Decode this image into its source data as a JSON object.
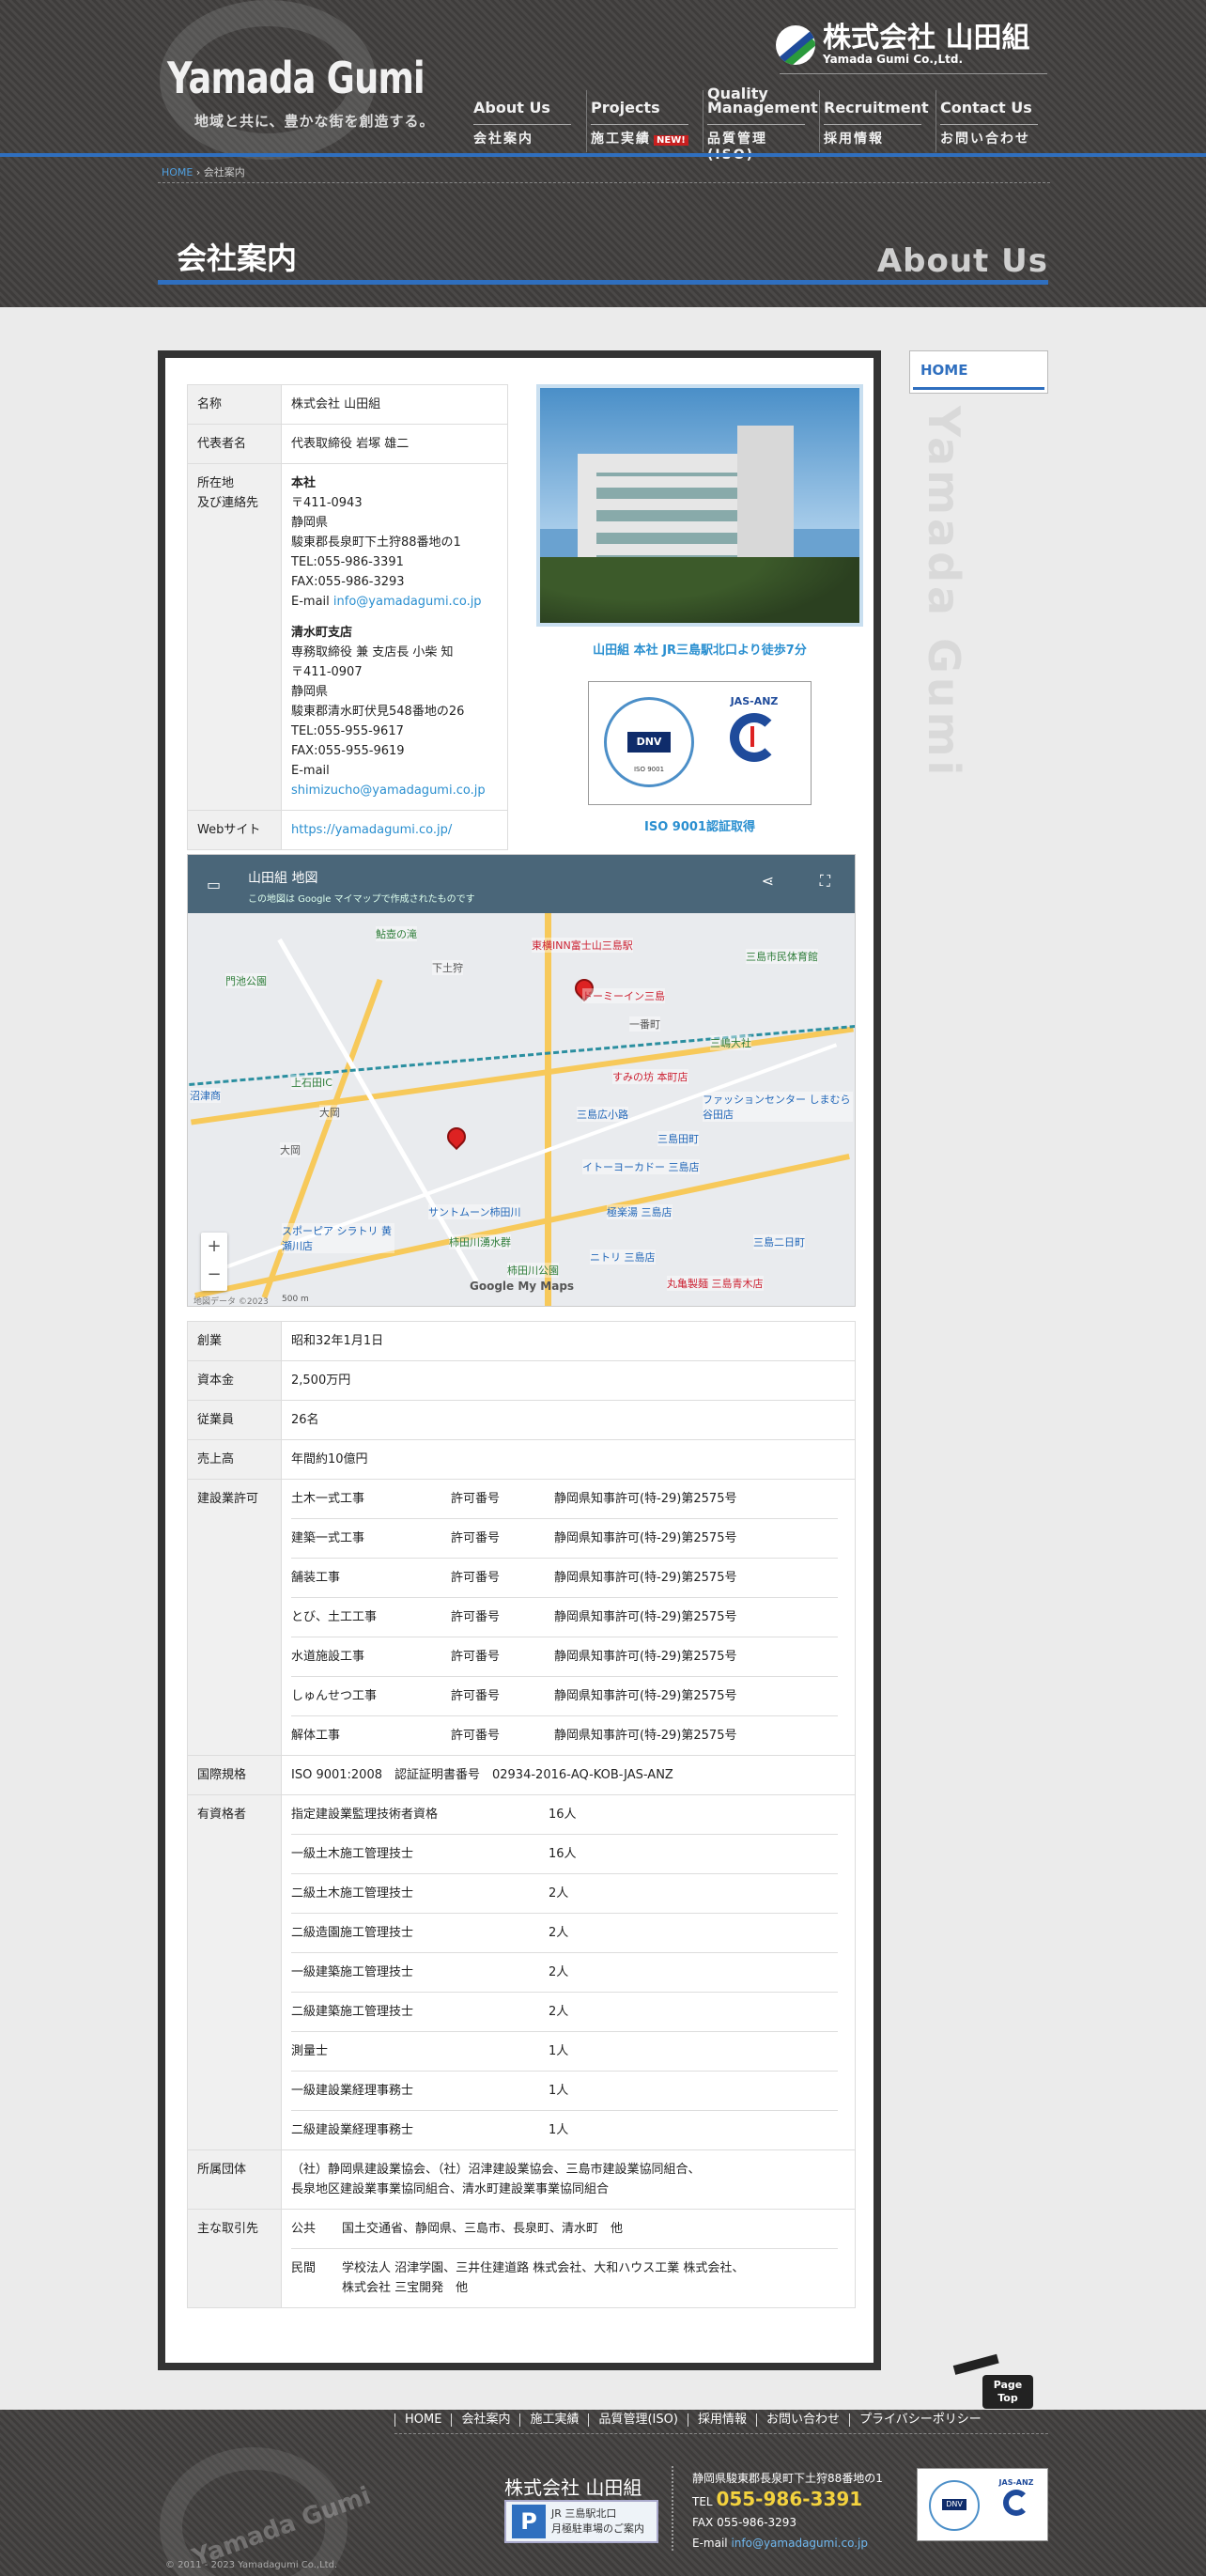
{
  "header": {
    "logo_title": "Yamada Gumi",
    "tagline": "地域と共に、豊かな街を創造する。",
    "corp_name": "株式会社 山田組",
    "corp_sub": "Yamada Gumi Co.,Ltd.",
    "nav": [
      {
        "en": "About Us",
        "jp": "会社案内"
      },
      {
        "en": "Projects",
        "jp": "施工実績",
        "badge": "NEW!"
      },
      {
        "en": "Quality Management",
        "jp": "品質管理(ISO)"
      },
      {
        "en": "Recruitment",
        "jp": "採用情報"
      },
      {
        "en": "Contact Us",
        "jp": "お問い合わせ"
      }
    ]
  },
  "breadcrumb": {
    "home": "HOME",
    "current": "会社案内"
  },
  "page": {
    "title": "会社案内",
    "title_en": "About Us"
  },
  "company": {
    "rows": [
      {
        "label": "名称",
        "value": "株式会社 山田組"
      },
      {
        "label": "代表者名",
        "value": "代表取締役 岩塚 雄二"
      }
    ],
    "location_label_1": "所在地",
    "location_label_2": "及び連絡先",
    "head_office": {
      "title": "本社",
      "lines": [
        "〒411-0943",
        "静岡県",
        "駿東郡長泉町下土狩88番地の1",
        "TEL:055-986-3391",
        "FAX:055-986-3293"
      ],
      "email_label": "E-mail",
      "email": "info@yamadagumi.co.jp"
    },
    "branch": {
      "title": "清水町支店",
      "lines": [
        "専務取締役 兼 支店長 小柴 知",
        "〒411-0907",
        "静岡県",
        "駿東郡清水町伏見548番地の26",
        "TEL:055-955-9617",
        "FAX:055-955-9619"
      ],
      "email_label": "E-mail",
      "email": "shimizucho@yamadagumi.co.jp"
    },
    "web_label": "Webサイト",
    "web_url": "https://yamadagumi.co.jp/",
    "photo_caption": "山田組 本社 JR三島駅北口より徒歩7分",
    "iso_caption": "ISO 9001認証取得",
    "iso_logo": {
      "dnv": "DNV",
      "dnv_iso": "ISO 9001",
      "jas": "JAS-ANZ"
    }
  },
  "map": {
    "title": "山田組 地図",
    "subtitle": "この地図は Google マイマップで作成されたものです",
    "share_icon": "share-icon",
    "fullscreen_icon": "fullscreen-icon",
    "google": "Google My Maps",
    "copyright": "地図データ ©2023",
    "scale": "500 m",
    "labels": [
      {
        "t": "東横INN富士山三島駅",
        "c": "pink"
      },
      {
        "t": "三島市民体育館",
        "c": "green"
      },
      {
        "t": "ドーミーイン三島",
        "c": "pink"
      },
      {
        "t": "三嶋大社",
        "c": "green"
      },
      {
        "t": "すみの坊 本町店",
        "c": "pink"
      },
      {
        "t": "ファッションセンター しまむら谷田店",
        "c": "blue"
      },
      {
        "t": "三島広小路",
        "c": "blue"
      },
      {
        "t": "イトーヨーカドー 三島店",
        "c": "blue"
      },
      {
        "t": "三島田町",
        "c": "blue"
      },
      {
        "t": "サントムーン柿田川",
        "c": "blue"
      },
      {
        "t": "極楽湯 三島店",
        "c": "blue"
      },
      {
        "t": "柿田川湧水群",
        "c": "green"
      },
      {
        "t": "スポーピア シラトリ 黄瀬川店",
        "c": "blue"
      },
      {
        "t": "丸亀製麺 三島青木店",
        "c": "pink"
      },
      {
        "t": "沼津商",
        "c": "blue"
      },
      {
        "t": "上石田IC",
        "c": "green"
      },
      {
        "t": "大岡",
        "c": ""
      },
      {
        "t": "大岡",
        "c": ""
      },
      {
        "t": "一番町",
        "c": ""
      },
      {
        "t": "三島二日町",
        "c": "blue"
      },
      {
        "t": "ニトリ 三島店",
        "c": "blue"
      },
      {
        "t": "柿田川公園",
        "c": "green"
      },
      {
        "t": "下土狩",
        "c": ""
      },
      {
        "t": "鮎壺の滝",
        "c": "green"
      },
      {
        "t": "門池公園",
        "c": "green"
      }
    ]
  },
  "details": {
    "rows": [
      {
        "label": "創業",
        "value": "昭和32年1月1日"
      },
      {
        "label": "資本金",
        "value": "2,500万円"
      },
      {
        "label": "従業員",
        "value": "26名"
      },
      {
        "label": "売上高",
        "value": "年間約10億円"
      }
    ],
    "license_label": "建設業許可",
    "licenses": [
      {
        "type": "土木一式工事",
        "key": "許可番号",
        "no": "静岡県知事許可(特-29)第2575号"
      },
      {
        "type": "建築一式工事",
        "key": "許可番号",
        "no": "静岡県知事許可(特-29)第2575号"
      },
      {
        "type": "舗装工事",
        "key": "許可番号",
        "no": "静岡県知事許可(特-29)第2575号"
      },
      {
        "type": "とび、土工工事",
        "key": "許可番号",
        "no": "静岡県知事許可(特-29)第2575号"
      },
      {
        "type": "水道施設工事",
        "key": "許可番号",
        "no": "静岡県知事許可(特-29)第2575号"
      },
      {
        "type": "しゅんせつ工事",
        "key": "許可番号",
        "no": "静岡県知事許可(特-29)第2575号"
      },
      {
        "type": "解体工事",
        "key": "許可番号",
        "no": "静岡県知事許可(特-29)第2575号"
      }
    ],
    "iso_label": "国際規格",
    "iso_value": "ISO 9001:2008　認証証明書番号　02934-2016-AQ-KOB-JAS-ANZ",
    "qual_label": "有資格者",
    "quals": [
      {
        "name": "指定建設業監理技術者資格",
        "count": "16人"
      },
      {
        "name": "一級土木施工管理技士",
        "count": "16人"
      },
      {
        "name": "二級土木施工管理技士",
        "count": "2人"
      },
      {
        "name": "二級造園施工管理技士",
        "count": "2人"
      },
      {
        "name": "一級建築施工管理技士",
        "count": "2人"
      },
      {
        "name": "二級建築施工管理技士",
        "count": "2人"
      },
      {
        "name": "測量士",
        "count": "1人"
      },
      {
        "name": "一級建設業経理事務士",
        "count": "1人"
      },
      {
        "name": "二級建設業経理事務士",
        "count": "1人"
      }
    ],
    "assoc_label": "所属団体",
    "assoc_value_1": "（社）静岡県建設業協会、（社）沼津建設業協会、三島市建設業協同組合、",
    "assoc_value_2": "長泉地区建設業事業協同組合、清水町建設業事業協同組合",
    "clients_label": "主な取引先",
    "clients": [
      {
        "kind": "公共",
        "value_1": "国土交通省、静岡県、三島市、長泉町、清水町　他",
        "value_2": ""
      },
      {
        "kind": "民間",
        "value_1": "学校法人 沼津学園、三井住建道路 株式会社、大和ハウス工業 株式会社、",
        "value_2": "株式会社 三宝開発　他"
      }
    ]
  },
  "sidebar": {
    "home": "HOME",
    "vertical": "Yamada Gumi"
  },
  "pagetop": {
    "line1": "Page",
    "line2": "Top"
  },
  "footer": {
    "nav": [
      "HOME",
      "会社案内",
      "施工実績",
      "品質管理(ISO)",
      "採用情報",
      "お問い合わせ",
      "プライバシーポリシー"
    ],
    "logo": "Yamada Gumi",
    "company": "株式会社 山田組",
    "parking_p": "P",
    "parking_1": "JR 三島駅北口",
    "parking_2": "月極駐車場のご案内",
    "address": "静岡県駿東郡長泉町下土狩88番地の1",
    "tel_label": "TEL",
    "tel": "055-986-3391",
    "fax_label": "FAX",
    "fax": "055-986-3293",
    "email_label": "E-mail",
    "email": "info@yamadagumi.co.jp",
    "copyright": "© 2011 - 2023 Yamadagumi Co.,Ltd."
  },
  "colors": {
    "accent": "#2f6fbf",
    "link": "#2a8fd0",
    "header_bg": "#444240"
  }
}
